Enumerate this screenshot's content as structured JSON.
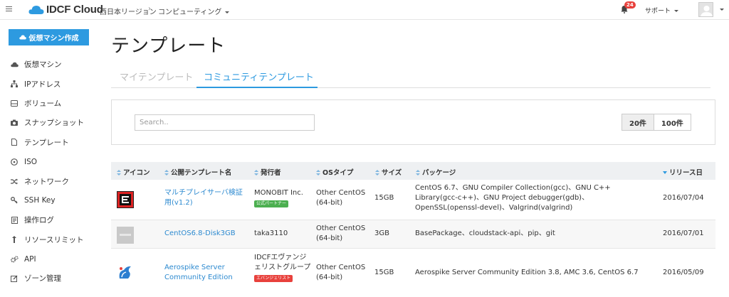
{
  "brand": {
    "name": "IDCF Cloud"
  },
  "breadcrumb": {
    "region": "西日本リージョン",
    "separator": "›",
    "service": "コンピューティング"
  },
  "header": {
    "notification_count": "24",
    "support_label": "サポート"
  },
  "sidebar": {
    "create_button": "仮想マシン作成",
    "items": [
      {
        "label": "仮想マシン",
        "icon": "cloud-icon"
      },
      {
        "label": "IPアドレス",
        "icon": "network-icon"
      },
      {
        "label": "ボリューム",
        "icon": "disk-icon"
      },
      {
        "label": "スナップショット",
        "icon": "camera-icon"
      },
      {
        "label": "テンプレート",
        "icon": "file-icon"
      },
      {
        "label": "ISO",
        "icon": "disc-icon"
      },
      {
        "label": "ネットワーク",
        "icon": "shuffle-icon"
      },
      {
        "label": "SSH Key",
        "icon": "key-icon"
      },
      {
        "label": "操作ログ",
        "icon": "log-icon"
      },
      {
        "label": "リソースリミット",
        "icon": "updown-icon"
      },
      {
        "label": "API",
        "icon": "gears-icon"
      },
      {
        "label": "ゾーン管理",
        "icon": "edit-icon"
      }
    ]
  },
  "main": {
    "title": "テンプレート",
    "tabs": [
      {
        "label": "マイテンプレート"
      },
      {
        "label": "コミュニティテンプレート"
      }
    ],
    "search": {
      "placeholder": "Search.."
    },
    "page_sizes": [
      "20件",
      "100件"
    ],
    "table": {
      "headers": [
        "アイコン",
        "公開テンプレート名",
        "発行者",
        "OSタイプ",
        "サイズ",
        "パッケージ",
        "リリース日"
      ],
      "rows": [
        {
          "name": "マルチプレイサーバ検証用(v1.2)",
          "publisher": "MONOBIT Inc.",
          "publisher_tag": "公式パートナー",
          "os": "Other CentOS (64-bit)",
          "size": "15GB",
          "packages": "CentOS 6.7、GNU Compiler Collection(gcc)、GNU C++ Library(gcc-c++)、GNU Project debugger(gdb)、OpenSSL(openssl-devel)、Valgrind(valgrind)",
          "date": "2016/07/04"
        },
        {
          "name": "CentOS6.8-Disk3GB",
          "publisher": "taka3110",
          "publisher_tag": "",
          "os": "Other CentOS (64-bit)",
          "size": "3GB",
          "packages": "BasePackage、cloudstack-api、pip、git",
          "date": "2016/07/01"
        },
        {
          "name": "Aerospike Server Community Edition",
          "publisher": "IDCFエヴァンジェリストグループ",
          "publisher_tag": "エバンジェリスト",
          "os": "Other CentOS (64-bit)",
          "size": "15GB",
          "packages": "Aerospike Server Community Edition 3.8, AMC 3.6, CentOS 6.7",
          "date": "2016/05/09"
        }
      ]
    }
  },
  "colors": {
    "accent": "#2d9ae0",
    "badge": "#e8413c"
  }
}
